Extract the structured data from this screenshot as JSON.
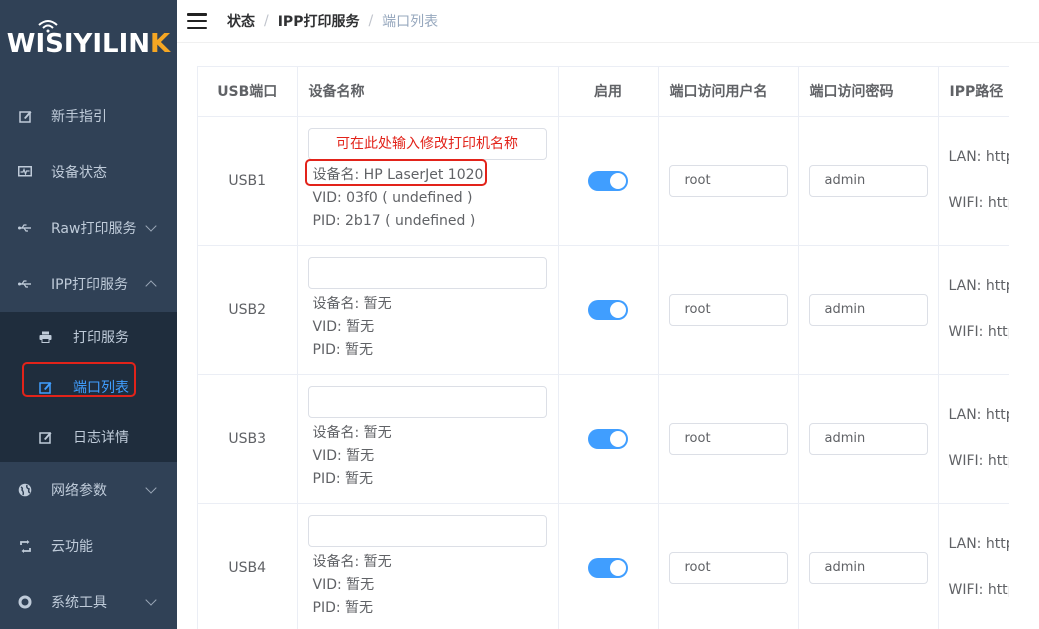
{
  "logo": {
    "text_main": "WISIYILIN",
    "text_end": "K"
  },
  "sidebar": {
    "items": [
      {
        "label": "新手指引",
        "icon": "edit-icon"
      },
      {
        "label": "设备状态",
        "icon": "monitor-icon"
      },
      {
        "label": "Raw打印服务",
        "icon": "usb-icon"
      },
      {
        "label": "IPP打印服务",
        "icon": "usb-icon"
      },
      {
        "label": "网络参数",
        "icon": "globe-icon"
      },
      {
        "label": "云功能",
        "icon": "sync-icon"
      },
      {
        "label": "系统工具",
        "icon": "lifebuoy-icon"
      }
    ],
    "submenu": [
      {
        "label": "打印服务",
        "icon": "printer-icon"
      },
      {
        "label": "端口列表",
        "icon": "edit-icon"
      },
      {
        "label": "日志详情",
        "icon": "edit-icon"
      }
    ]
  },
  "breadcrumb": {
    "root": "状态",
    "section": "IPP打印服务",
    "current": "端口列表",
    "separator": "/"
  },
  "table": {
    "headers": [
      "USB端口",
      "设备名称",
      "启用",
      "端口访问用户名",
      "端口访问密码",
      "IPP路径"
    ],
    "rows": [
      {
        "port": "USB1",
        "name_input": "可在此处输入修改打印机名称",
        "device": "设备名: HP LaserJet 1020",
        "vid": "VID: 03f0 ( undefined )",
        "pid": "PID: 2b17 ( undefined )",
        "enabled": true,
        "username": "root",
        "password": "admin",
        "lan": "LAN: http",
        "wifi": "WIFI: http"
      },
      {
        "port": "USB2",
        "name_input": "",
        "device": "设备名: 暂无",
        "vid": "VID: 暂无",
        "pid": "PID: 暂无",
        "enabled": true,
        "username": "root",
        "password": "admin",
        "lan": "LAN: http",
        "wifi": "WIFI: http"
      },
      {
        "port": "USB3",
        "name_input": "",
        "device": "设备名: 暂无",
        "vid": "VID: 暂无",
        "pid": "PID: 暂无",
        "enabled": true,
        "username": "root",
        "password": "admin",
        "lan": "LAN: http",
        "wifi": "WIFI: http"
      },
      {
        "port": "USB4",
        "name_input": "",
        "device": "设备名: 暂无",
        "vid": "VID: 暂无",
        "pid": "PID: 暂无",
        "enabled": true,
        "username": "root",
        "password": "admin",
        "lan": "LAN: http",
        "wifi": "WIFI: http"
      }
    ]
  },
  "colors": {
    "sidebar_bg": "#304156",
    "submenu_bg": "#1f2d3d",
    "accent": "#409eff",
    "highlight": "#e2231a"
  }
}
